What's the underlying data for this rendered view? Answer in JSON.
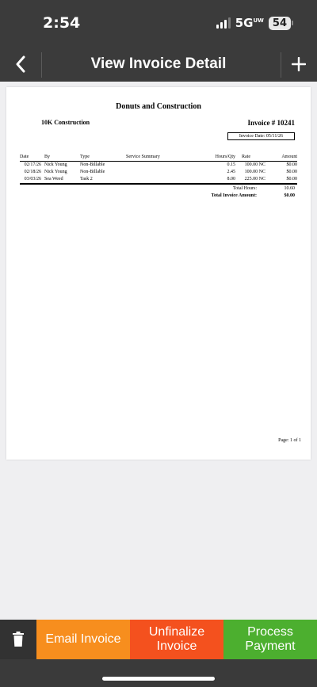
{
  "status": {
    "time": "2:54",
    "network": "5G",
    "network_sup": "UW",
    "battery": "54"
  },
  "nav": {
    "title": "View Invoice Detail"
  },
  "invoice": {
    "company": "Donuts and Construction",
    "client": "10K Construction",
    "invoice_number": "Invoice # 10241",
    "invoice_date": "Invoice Date: 05/11/26",
    "columns": {
      "date": "Date",
      "by": "By",
      "type": "Type",
      "summary": "Service Summary",
      "hours": "Hours/Qty",
      "rate": "Rate",
      "amount": "Amount"
    },
    "rows": [
      {
        "date": "02/17/26",
        "by": "Nick Young",
        "type": "Non-Billable",
        "summary": "",
        "hours": "0.15",
        "rate": "100.00 NC",
        "amount": "$0.00"
      },
      {
        "date": "02/18/26",
        "by": "Nick Young",
        "type": "Non-Billable",
        "summary": "",
        "hours": "2.45",
        "rate": "100.00 NC",
        "amount": "$0.00"
      },
      {
        "date": "03/03/26",
        "by": "Sea Weed",
        "type": "Task 2",
        "summary": "",
        "hours": "8.00",
        "rate": "225.00 NC",
        "amount": "$0.00"
      }
    ],
    "total_hours_label": "Total Hours:",
    "total_hours": "10.60",
    "total_amount_label": "Total Invoice Amount:",
    "total_amount": "$0.00",
    "page": "Page: 1 of 1"
  },
  "actions": {
    "trash_icon": "trash-icon",
    "email": "Email Invoice",
    "unfinalize_1": "Unfinalize",
    "unfinalize_2": "Invoice",
    "process_1": "Process",
    "process_2": "Payment"
  },
  "colors": {
    "email": "#f78e1e",
    "unfinalize": "#f4511e",
    "process": "#4caf2f",
    "bar": "#3b3b3b"
  }
}
